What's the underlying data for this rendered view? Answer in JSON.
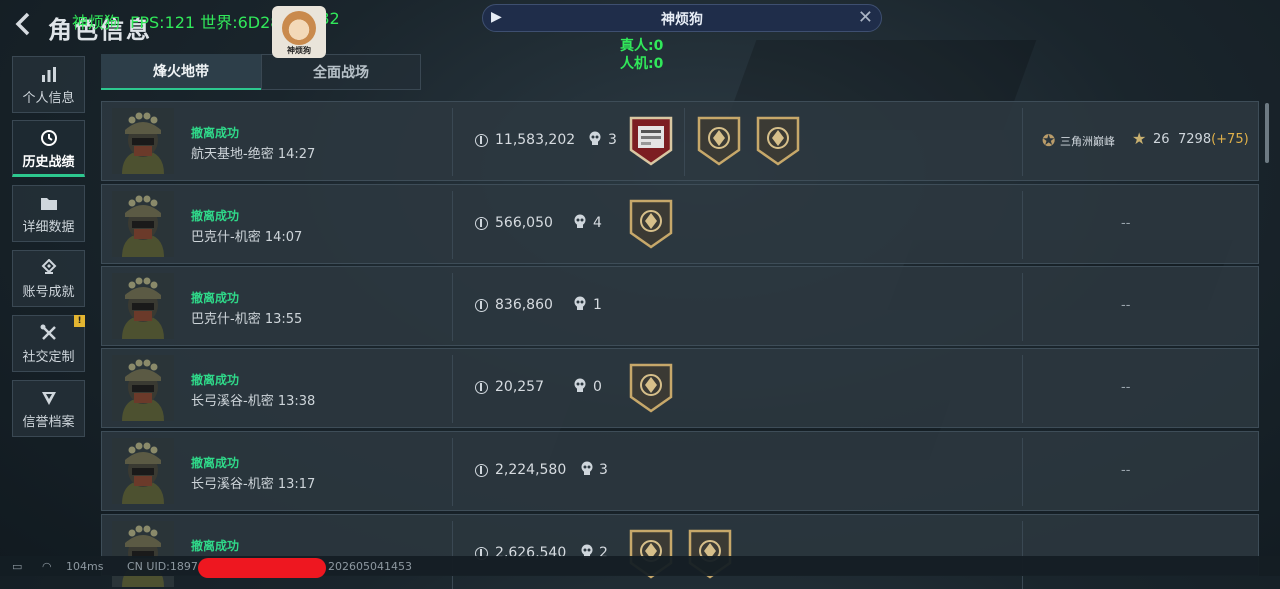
{
  "header": {
    "title": "角色信息"
  },
  "overlay": {
    "stats_text": "神烦狗  FPS:121 世界:6D28",
    "stats_tail": "0 82",
    "streamer_label": "神烦狗"
  },
  "spectate": {
    "player_name": "神烦狗",
    "real_count": "真人:0",
    "bot_count": "人机:0"
  },
  "sidebar": {
    "items": [
      {
        "label": "个人信息",
        "icon": "bar-chart-icon"
      },
      {
        "label": "历史战绩",
        "icon": "clock-icon"
      },
      {
        "label": "详细数据",
        "icon": "folder-icon"
      },
      {
        "label": "账号成就",
        "icon": "achievement-icon"
      },
      {
        "label": "社交定制",
        "icon": "tools-icon"
      },
      {
        "label": "信誉档案",
        "icon": "shield-icon"
      }
    ],
    "notice_mark": "!"
  },
  "tabs": [
    {
      "label": "烽火地带"
    },
    {
      "label": "全面战场"
    }
  ],
  "records": [
    {
      "status": "撤离成功",
      "map": "航天基地-绝密 14:27",
      "value": "11,583,202",
      "kills": "3",
      "rank": {
        "name": "三角洲巅峰",
        "level": "26",
        "points": "7298",
        "delta": "(+75)"
      }
    },
    {
      "status": "撤离成功",
      "map": "巴克什-机密 14:07",
      "value": "566,050",
      "kills": "4",
      "dash": "--"
    },
    {
      "status": "撤离成功",
      "map": "巴克什-机密 13:55",
      "value": "836,860",
      "kills": "1",
      "dash": "--"
    },
    {
      "status": "撤离成功",
      "map": "长弓溪谷-机密 13:38",
      "value": "20,257",
      "kills": "0",
      "dash": "--"
    },
    {
      "status": "撤离成功",
      "map": "长弓溪谷-机密 13:17",
      "value": "2,224,580",
      "kills": "3",
      "dash": "--"
    },
    {
      "status": "撤离成功",
      "map": "",
      "value": "2,626,540",
      "kills": "2",
      "dash": ""
    }
  ],
  "footer": {
    "ping": "104ms",
    "uid_prefix": "CN UID:1897",
    "uid_suffix": "202605041453"
  },
  "colors": {
    "accent_green": "#2fd889",
    "overlay_green": "#31e85a",
    "redact_red": "#ee1720"
  }
}
